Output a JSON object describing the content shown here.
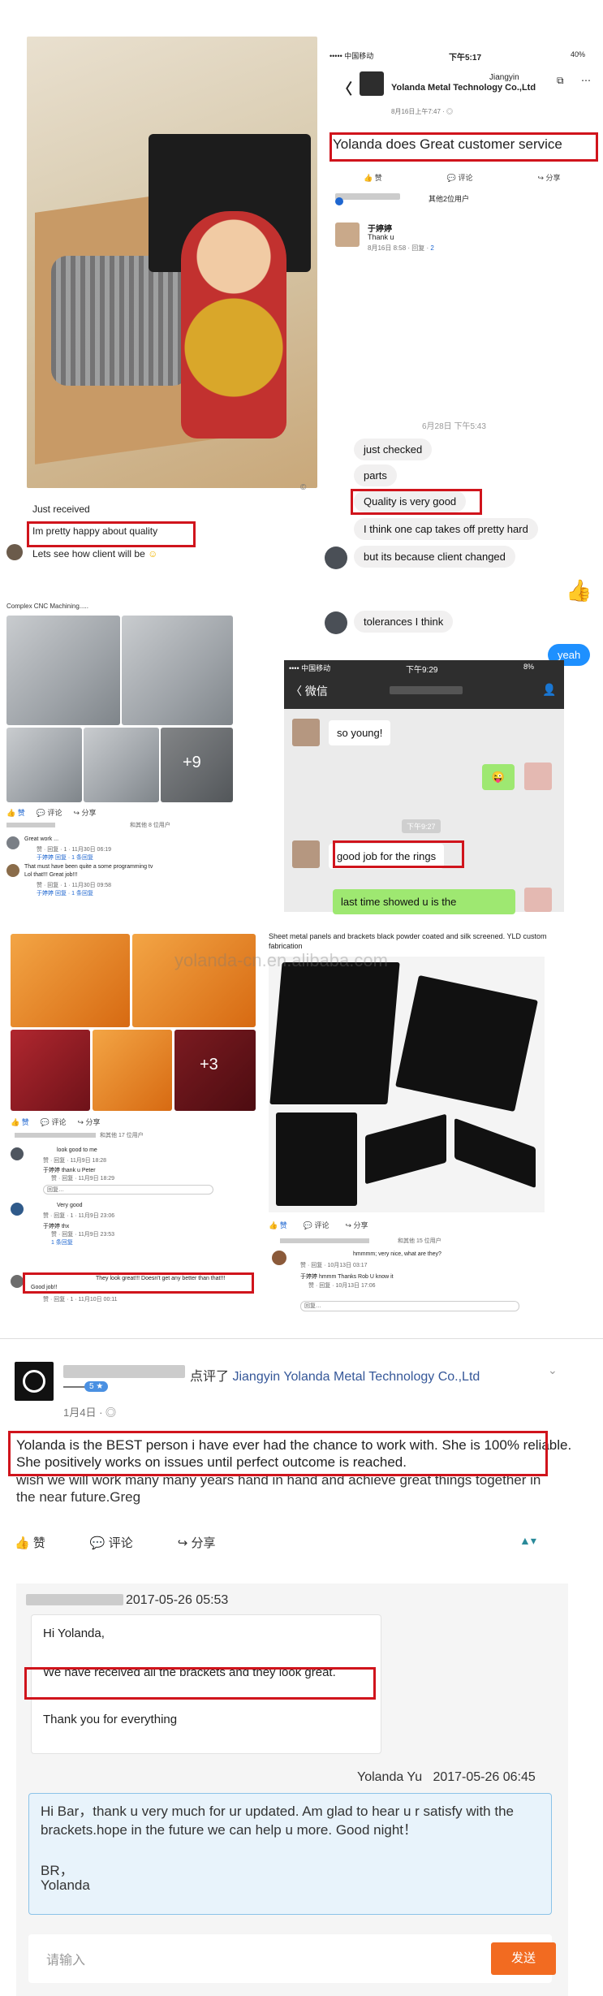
{
  "header_caption": "",
  "s1": {
    "caption1": "Just received",
    "caption2": "Im pretty happy about quality",
    "caption3": "Lets see how client will be",
    "caption3_emoji": "☺",
    "icon_badge": "©"
  },
  "s2": {
    "carrier": "••••• 中国移动",
    "time": "下午5:17",
    "battery": "40%",
    "back": "〈",
    "location": "Jiangyin",
    "company": "Yolanda Metal Technology Co.,Ltd",
    "date": "8月16日上午7:47 · ◎",
    "post_text": "Yolanda does Great customer service",
    "like": "赞",
    "comment": "评论",
    "share": "分享",
    "others": "其他2位用户",
    "commenter": "于婷婷",
    "comment_text": "Thank u",
    "comment_meta": "8月16日 8:58 · 回复 ·",
    "comment_count": "2"
  },
  "s3": {
    "timestamp": "6月28日 下午5:43",
    "m1": "just checked",
    "m2": "parts",
    "m3": "Quality is very good",
    "m4": "I think one cap takes off pretty hard",
    "m5": "but its because client changed",
    "m6": "tolerances I think",
    "m7": "yeah"
  },
  "s4": {
    "title": "Complex CNC Machining.....",
    "more": "+9",
    "like": "赞",
    "comment": "评论",
    "share": "分享",
    "likes_line": "和其他 8 位用户",
    "c1": "Great work ...",
    "c1_meta": "赞 · 回复 · 1 · 11月30日 06:19",
    "c2": "That must have been quite a some programming tv",
    "c2_sub": "Lol that!!! Great job!!!",
    "c2_meta": "赞 · 回复 · 1 · 11月30日 09:58",
    "reply_label": "于婷婷 回复 · 1 条回复"
  },
  "s5": {
    "carrier": "•••• 中国移动",
    "time": "下午9:29",
    "battery": "8%",
    "back": "微信",
    "timestamp": "下午9:27",
    "m1": "so young!",
    "m2": "😜",
    "m3": "good job for the rings",
    "m4": "last time showed u is the"
  },
  "s6": {
    "more": "+3",
    "like": "赞",
    "comment": "评论",
    "share": "分享",
    "likes_line": "和其他 17 位用户",
    "c1": "look good to me",
    "c1_meta": "赞 · 回复 · 11月9日 18:28",
    "c1_reply": "于婷婷 thank u Peter",
    "c1_reply_meta": "赞 · 回复 · 11月9日 18:29",
    "reply_placeholder": "回复…",
    "c2": "Very good",
    "c2_meta": "赞 · 回复 · 1 · 11月9日 23:06",
    "c2_reply": "于婷婷 thx",
    "c2_reply_meta": "赞 · 回复 · 11月9日 23:53",
    "c2_more": "1 条回复",
    "c3": "They look great!!! Doesn't get any better than that!!!",
    "c3_sub": "Good job!!",
    "c3_meta": "赞 · 回复 · 1 · 11月10日 00:11"
  },
  "s7": {
    "title": "Sheet metal panels and brackets black powder coated and silk screened. YLD custom fabrication",
    "like": "赞",
    "comment": "评论",
    "share": "分享",
    "likes_line": "和其他 15 位用户",
    "c1": "hmmmm; very nice, what are they?",
    "c1_meta": "赞 · 回复 · 10月13日 03:17",
    "c1_reply": "于婷婷 hmmm Thanks Rob U know it",
    "c1_reply_meta": "赞 · 回复 · 10月13日 17:06",
    "reply_placeholder": "回复…",
    "watermark": "yolanda-cn.en.alibaba.com"
  },
  "s8": {
    "reviewed": "点评了",
    "company": "Jiangyin Yolanda Metal Technology Co.,Ltd",
    "rating": "5 ★",
    "date": "1月4日 · ◎",
    "review_hl": "Yolanda is the BEST person i have ever had the chance to work with. She is 100% reliable. She positively works on issues until perfect outcome is reached.",
    "review_rest": "wish we will work many many years hand in hand and achieve great things together in the near future.Greg",
    "like": "赞",
    "comment": "评论",
    "share": "分享"
  },
  "s9": {
    "date1": "2017-05-26 05:53",
    "hi": "Hi Yolanda,",
    "received": "We have received all the brackets and they look great.",
    "thanks": "Thank you for everything",
    "sender2": "Yolanda Yu",
    "date2": "2017-05-26 06:45",
    "reply": "Hi Bar，thank u very much for ur updated. Am glad to hear u r satisfy with the brackets.hope in the future we can help u more. Good night！",
    "br": "BR，",
    "sign": "Yolanda",
    "input_placeholder": "请输入",
    "send": "发送"
  },
  "colors": {
    "highlight": "#d0141c",
    "messenger_blue": "#1e90ff",
    "wechat_green": "#9ee871",
    "send_orange": "#f26b21",
    "reply_bg": "#e8f3fb"
  }
}
